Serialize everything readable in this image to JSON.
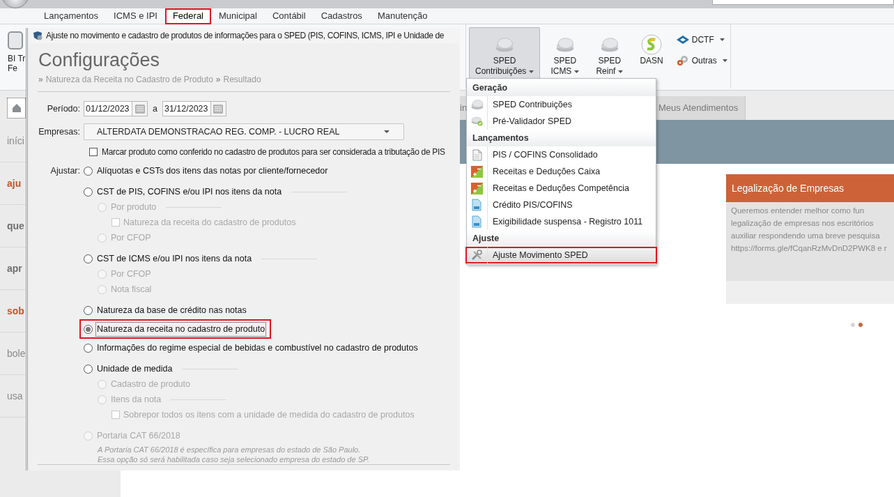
{
  "menu_tabs": [
    {
      "label": "Lançamentos",
      "selected": false,
      "highlighted": false
    },
    {
      "label": "ICMS e IPI",
      "selected": false,
      "highlighted": false
    },
    {
      "label": "Federal",
      "selected": true,
      "highlighted": true
    },
    {
      "label": "Municipal",
      "selected": false,
      "highlighted": false
    },
    {
      "label": "Contábil",
      "selected": false,
      "highlighted": false
    },
    {
      "label": "Cadastros",
      "selected": false,
      "highlighted": false
    },
    {
      "label": "Manutenção",
      "selected": false,
      "highlighted": false
    }
  ],
  "ribbon": {
    "left_button": {
      "lines": [
        "BI Tr",
        "Fe"
      ]
    },
    "buttons": [
      {
        "kind": "large",
        "lines": [
          "SPED",
          "Contribuições"
        ],
        "dropdown": true,
        "pressed": true
      },
      {
        "kind": "large",
        "lines": [
          "SPED",
          "ICMS"
        ],
        "dropdown": true,
        "pressed": false
      },
      {
        "kind": "large",
        "lines": [
          "SPED",
          "Reinf"
        ],
        "dropdown": true,
        "pressed": false
      },
      {
        "kind": "large",
        "lines": [
          "DASN"
        ],
        "dropdown": false,
        "pressed": false
      }
    ],
    "small_buttons": [
      {
        "label": "DCTF",
        "dropdown": true
      },
      {
        "label": "Outras",
        "dropdown": true
      }
    ]
  },
  "content_tabs": [
    {
      "label": "in",
      "selected": false
    },
    {
      "label": "Meus Atendimentos",
      "selected": false
    }
  ],
  "sidebar": {
    "items": [
      {
        "label": "iníci",
        "color": "#8a8a8a"
      },
      {
        "label": "aju",
        "color": "#c8552a"
      },
      {
        "label": "que",
        "color": "#6f6f6f"
      },
      {
        "label": "apr",
        "color": "#6f6f6f"
      },
      {
        "label": "sob",
        "color": "#c8552a"
      },
      {
        "label": "bole",
        "color": "#8a8a8a"
      },
      {
        "label": "usa",
        "color": "#8a8a8a"
      }
    ]
  },
  "card": {
    "title": "Legalização de Empresas",
    "lines": [
      "Queremos entender melhor como fun",
      "legalização de empresas nos escritórios",
      "auxiliar respondendo uma breve pesquisa",
      "https://forms.gle/fCqanRzMvDnD2PWK8 e r"
    ]
  },
  "carousel": {
    "dots": [
      {
        "selected": false
      },
      {
        "selected": true
      }
    ]
  },
  "dialog": {
    "title": "Ajuste no movimento e cadastro de produtos de informações para o SPED (PIS, COFINS, ICMS, IPI e Unidade de",
    "heading": "Configurações",
    "breadcrumb": {
      "separator": "»",
      "items": [
        "Natureza da Receita no Cadastro de Produto",
        "Resultado"
      ]
    },
    "period": {
      "label": "Período:",
      "from": "01/12/2023",
      "between": "a",
      "to": "31/12/2023"
    },
    "company": {
      "label": "Empresas:",
      "value": "ALTERDATA DEMONSTRACAO REG. COMP. - LUCRO REAL"
    },
    "mark_checkbox": {
      "label": "Marcar produto como conferido no cadastro de produtos para ser considerada a tributação de PIS",
      "checked": false
    },
    "adjust_label": "Ajustar:",
    "options": [
      {
        "kind": "radio",
        "label": "Alíquotas e CSTs dos itens das notas por cliente/fornecedor",
        "selected": false,
        "disabled": false,
        "highlighted": false
      },
      {
        "kind": "radio",
        "label": "CST de PIS, COFINS e/ou IPI nos itens da nota",
        "selected": false,
        "disabled": false,
        "highlighted": false,
        "children": [
          {
            "kind": "radio",
            "label": "Por produto",
            "selected": false,
            "disabled": true,
            "highlighted": false,
            "children": [
              {
                "kind": "checkbox",
                "label": "Natureza da receita do cadastro de produtos",
                "checked": false,
                "disabled": true
              }
            ]
          },
          {
            "kind": "radio",
            "label": "Por CFOP",
            "selected": false,
            "disabled": true,
            "highlighted": false
          }
        ]
      },
      {
        "kind": "radio",
        "label": "CST de ICMS e/ou IPI nos itens da nota",
        "selected": false,
        "disabled": false,
        "highlighted": false,
        "children": [
          {
            "kind": "radio",
            "label": "Por CFOP",
            "selected": false,
            "disabled": true,
            "highlighted": false
          },
          {
            "kind": "radio",
            "label": "Nota fiscal",
            "selected": false,
            "disabled": true,
            "highlighted": false
          }
        ]
      },
      {
        "kind": "radio",
        "label": "Natureza da base de crédito nas notas",
        "selected": false,
        "disabled": false,
        "highlighted": false
      },
      {
        "kind": "radio",
        "label": "Natureza da receita no cadastro de produto",
        "selected": true,
        "disabled": false,
        "highlighted": true
      },
      {
        "kind": "radio",
        "label": "Informações do regime especial de bebidas e combustível no cadastro de produtos",
        "selected": false,
        "disabled": false,
        "highlighted": false
      },
      {
        "kind": "radio",
        "label": "Unidade de medida",
        "selected": false,
        "disabled": false,
        "highlighted": false,
        "children": [
          {
            "kind": "radio",
            "label": "Cadastro de produto",
            "selected": false,
            "disabled": true,
            "highlighted": false
          },
          {
            "kind": "radio",
            "label": "Itens da nota",
            "selected": false,
            "disabled": true,
            "highlighted": false,
            "children": [
              {
                "kind": "checkbox",
                "label": "Sobrepor todos os itens com a unidade de medida do cadastro de produtos",
                "checked": false,
                "disabled": true
              }
            ]
          }
        ]
      },
      {
        "kind": "radio",
        "label": "Portaria CAT 66/2018",
        "selected": false,
        "disabled": true,
        "highlighted": false,
        "note": [
          "A Portaria CAT 66/2018 é específica para empresas do estado de São Paulo.",
          "Essa opção só será habilitada caso seja selecionado empresa do estado de SP."
        ]
      }
    ]
  },
  "dropdown_menu": {
    "sections": [
      {
        "title": "Geração",
        "items": [
          {
            "label": "SPED Contribuições",
            "highlighted": false
          },
          {
            "label": "Pré-Validador SPED",
            "highlighted": false
          }
        ]
      },
      {
        "title": "Lançamentos",
        "items": [
          {
            "label": "PIS / COFINS Consolidado",
            "highlighted": false
          },
          {
            "label": "Receitas e Deduções Caixa",
            "highlighted": false
          },
          {
            "label": "Receitas e Deduções Competência",
            "highlighted": false
          },
          {
            "label": "Crédito PIS/COFINS",
            "highlighted": false
          },
          {
            "label": "Exigibilidade suspensa - Registro 1011",
            "highlighted": false
          }
        ]
      },
      {
        "title": "Ajuste",
        "items": [
          {
            "label": "Ajuste Movimento SPED",
            "highlighted": true
          }
        ]
      }
    ]
  }
}
